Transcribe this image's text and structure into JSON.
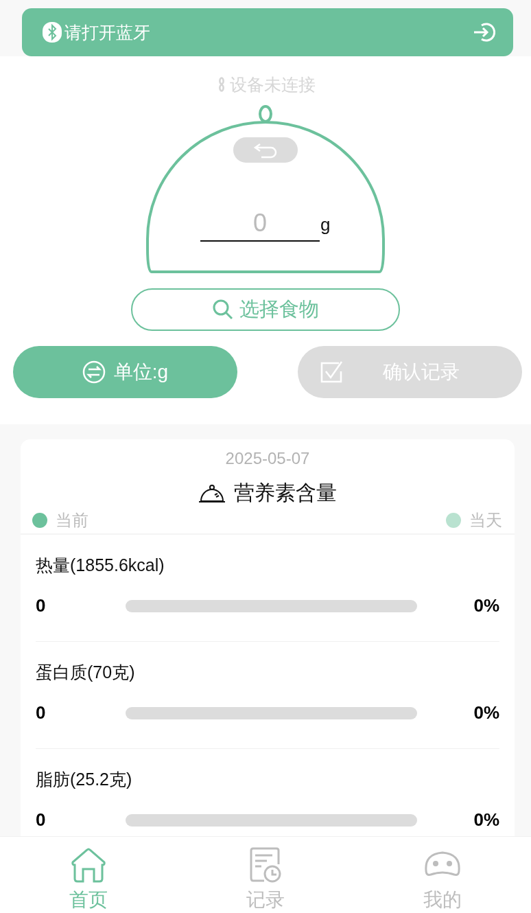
{
  "banner": {
    "text": "请打开蓝牙"
  },
  "device_status": "设备未连接",
  "scale": {
    "placeholder": "0",
    "unit": "g"
  },
  "select_food_button": "选择食物",
  "unit_button": "单位:g",
  "confirm_button": {
    "label": "确认记录",
    "disabled": true
  },
  "nutrition": {
    "date": "2025-05-07",
    "title": "营养素含量",
    "legend": [
      {
        "label": "当前",
        "color": "#6cc19c"
      },
      {
        "label": "当天",
        "color": "#b9e2d0"
      }
    ],
    "items": [
      {
        "name": "热量(1855.6kcal)",
        "value": "0",
        "level": 0,
        "percent": "0%"
      },
      {
        "name": "蛋白质(70克)",
        "value": "0",
        "level": 0,
        "percent": "0%"
      },
      {
        "name": "脂肪(25.2克)",
        "value": "0",
        "level": 0,
        "percent": "0%"
      }
    ]
  },
  "tab_bar": [
    {
      "label": "首页",
      "selected": true
    },
    {
      "label": "记录",
      "selected": false
    },
    {
      "label": "我的",
      "selected": false
    }
  ]
}
